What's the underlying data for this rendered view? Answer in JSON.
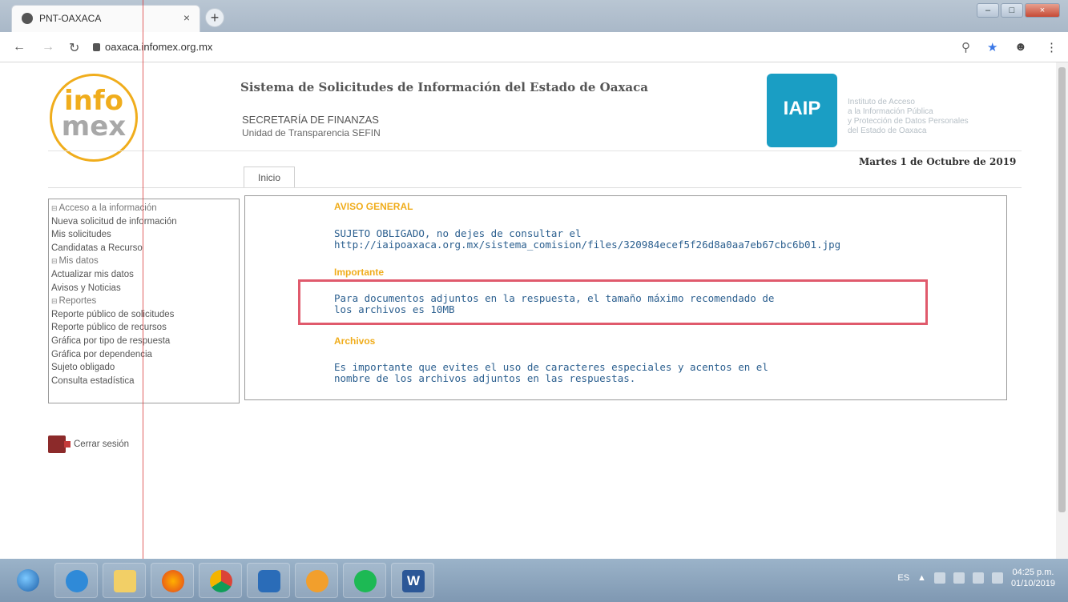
{
  "browser": {
    "tab_title": "PNT-OAXACA",
    "tab_close": "×",
    "new_tab": "+",
    "url": "oaxaca.infomex.org.mx",
    "window_controls": {
      "minimize": "–",
      "maximize": "□",
      "close": "×"
    },
    "icons": [
      "back-icon",
      "forward-icon",
      "reload-icon",
      "lock-icon",
      "zoom-icon",
      "star-icon",
      "account-icon",
      "menu-icon"
    ]
  },
  "header": {
    "logo_top": "info",
    "logo_bottom": "mex",
    "system_title": "Sistema de Solicitudes de Información del Estado de Oaxaca",
    "department": "SECRETARÍA DE FINANZAS",
    "unit": "Unidad de Transparencia SEFIN",
    "iaip_logo": "IAIP",
    "iaip_description": [
      "Instituto de Acceso",
      "a la Información Pública",
      "y Protección de Datos Personales",
      "del Estado de Oaxaca"
    ],
    "date": "Martes 1 de Octubre de 2019"
  },
  "nav": {
    "home_tab": "Inicio"
  },
  "sidebar": {
    "items": [
      {
        "label": "Acceso a la información",
        "section": true
      },
      {
        "label": "Nueva solicitud de información",
        "section": false
      },
      {
        "label": "Mis solicitudes",
        "section": false
      },
      {
        "label": "Candidatas a Recurso",
        "section": false
      },
      {
        "label": "Mis datos",
        "section": true
      },
      {
        "label": "Actualizar mis datos",
        "section": false
      },
      {
        "label": "Avisos y Noticias",
        "section": false
      },
      {
        "label": "Reportes",
        "section": true
      },
      {
        "label": "Reporte público de solicitudes",
        "section": false
      },
      {
        "label": "Reporte público de recursos",
        "section": false
      },
      {
        "label": "Gráfica por tipo de respuesta",
        "section": false
      },
      {
        "label": "Gráfica por dependencia",
        "section": false
      },
      {
        "label": "Sujeto obligado",
        "section": false
      },
      {
        "label": "Consulta estadística",
        "section": false
      }
    ],
    "logout": "Cerrar sesión"
  },
  "main": {
    "notice_title": "AVISO GENERAL",
    "notice_line1": "SUJETO OBLIGADO, no dejes de consultar el",
    "notice_line2": "http://iaipoaxaca.org.mx/sistema_comision/files/320984ecef5f26d8a0aa7eb67cbc6b01.jpg",
    "important_title": "Importante",
    "important_line1": "Para documentos adjuntos en la respuesta, el tamaño máximo recomendado de",
    "important_line2": "los archivos es 10MB",
    "files_title": "Archivos",
    "files_line1": "Es importante que evites el uso de caracteres especiales y acentos en el",
    "files_line2": "nombre de los archivos adjuntos en las respuestas."
  },
  "taskbar": {
    "apps": [
      "start",
      "internet-explorer",
      "file-explorer",
      "firefox",
      "chrome",
      "media-player",
      "settings",
      "spotify",
      "word"
    ],
    "word_letter": "W",
    "language": "ES",
    "time": "04:25 p.m.",
    "date": "01/10/2019"
  },
  "colors": {
    "accent_orange": "#f0ad1c",
    "text_blue": "#2b5f8f",
    "highlight_red": "#e05a6c",
    "iaip_blue": "#1a9ec4"
  }
}
